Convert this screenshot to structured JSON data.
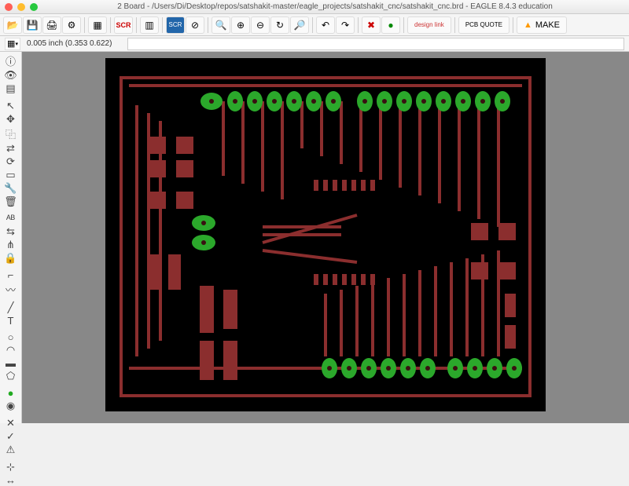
{
  "window": {
    "title": "2 Board - /Users/Di/Desktop/repos/satshakit-master/eagle_projects/satshakit_cnc/satshakit_cnc.brd - EAGLE 8.4.3 education"
  },
  "toolbar": {
    "scr_label": "SCR",
    "design_link": "design link",
    "pcb_quote": "PCB QUOTE",
    "make": "MAKE"
  },
  "coords": {
    "text": "0.005 inch (0.353 0.622)",
    "cmd_value": ""
  },
  "left_tools": [
    "info",
    "eye",
    "layers",
    "—",
    "select",
    "move",
    "copy",
    "mirror",
    "rotate",
    "group",
    "cut",
    "delete",
    "—",
    "name",
    "value",
    "split",
    "lock",
    "—",
    "dim",
    "text",
    "—",
    "miter",
    "route",
    "—",
    "wire",
    "text2",
    "—",
    "line",
    "arc",
    "circle",
    "rect",
    "poly",
    "—",
    "via",
    "hole",
    "—",
    "ratsnest",
    "drc",
    "errors",
    "—",
    "mark"
  ],
  "pcb": {
    "trace_color": "#8b2e2e",
    "pad_color": "#2ba82b",
    "hole_color": "#3a1111"
  }
}
